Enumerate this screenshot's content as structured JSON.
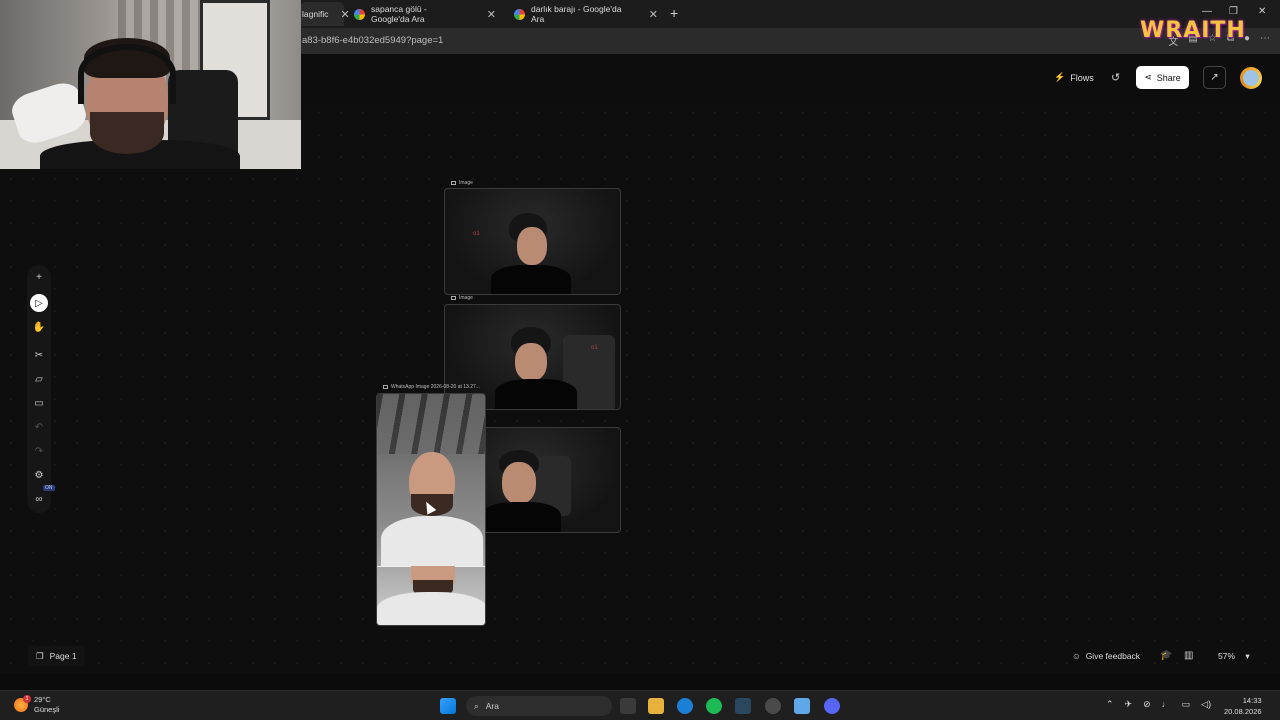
{
  "browser": {
    "tabs": [
      {
        "label": "lagnific",
        "active": true
      },
      {
        "label": "sapanca gölü - Google'da Ara",
        "active": false
      },
      {
        "label": "darlık barajı - Google'da Ara",
        "active": false
      }
    ],
    "url": "a83-b8f6-e4b032ed5949?page=1",
    "overlay_logo": "WRAITH"
  },
  "app": {
    "topbar": {
      "flows_label": "Flows",
      "share_label": "Share"
    },
    "nodes": [
      {
        "label": "Image"
      },
      {
        "label": "Image"
      },
      {
        "label": "WhatsApp Image 2026-08-20 at 13.27..."
      }
    ],
    "toolbar": {
      "badge": "ON"
    },
    "bottom": {
      "page_label": "Page 1",
      "feedback_label": "Give feedback",
      "zoom": "57%"
    }
  },
  "taskbar": {
    "temperature": "29°C",
    "condition": "Güneşli",
    "weather_badge": "1",
    "search_placeholder": "Ara",
    "time": "14:33",
    "date": "20.08.2026"
  },
  "colors": {
    "canvas_bg": "#0e0e0e",
    "share_bg": "#ffffff",
    "logo": "#f2c53d"
  }
}
